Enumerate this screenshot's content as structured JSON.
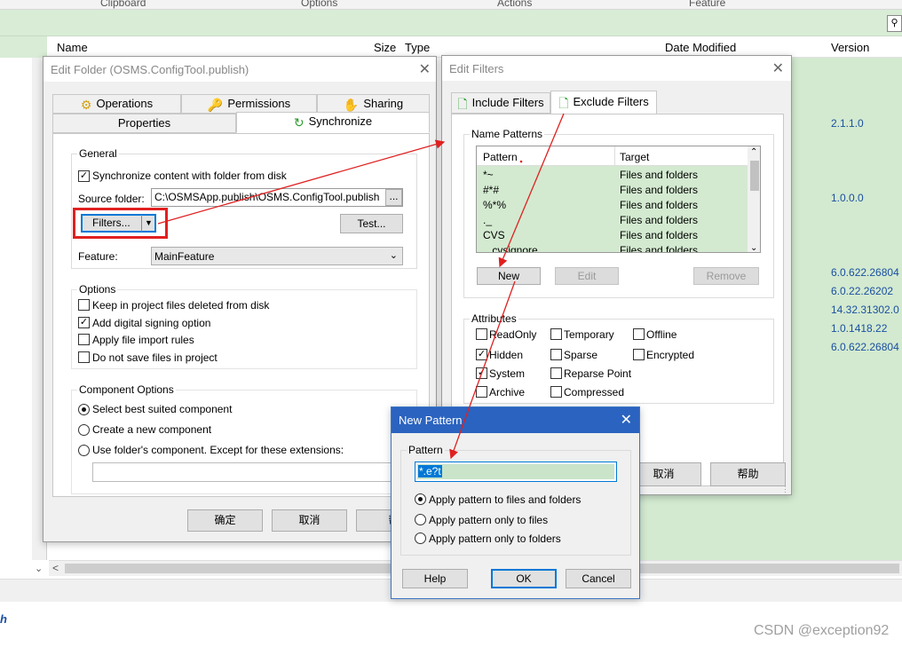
{
  "ribbon": {
    "groups": [
      "Clipboard",
      "Options",
      "Actions",
      "Feature"
    ]
  },
  "search_icon": "search-icon",
  "list": {
    "headers": {
      "name": "Name",
      "size": "Size",
      "type": "Type",
      "date_modified": "Date Modified",
      "version": "Version"
    },
    "versions": [
      "2.1.1.0",
      "1.0.0.0",
      "6.0.622.26804",
      "6.0.22.26202",
      "14.32.31302.0",
      "1.0.1418.22",
      "6.0.622.26804"
    ]
  },
  "bottom_link": "h",
  "watermark": "CSDN @exception92",
  "edit_folder": {
    "title": "Edit Folder (OSMS.ConfigTool.publish)",
    "tabs": [
      "Operations",
      "Permissions",
      "Sharing",
      "Properties",
      "Synchronize"
    ],
    "general_label": "General",
    "sync_checkbox": "Synchronize content with folder from disk",
    "source_folder_label": "Source folder:",
    "source_folder_value": "C:\\OSMSApp.publish\\OSMS.ConfigTool.publish",
    "browse_label": "...",
    "filters_button": "Filters...",
    "test_button": "Test...",
    "feature_label": "Feature:",
    "feature_value": "MainFeature",
    "options_label": "Options",
    "options": [
      "Keep in project files deleted from disk",
      "Add digital signing option",
      "Apply file import rules",
      "Do not save files in project"
    ],
    "options_checked": [
      false,
      true,
      false,
      false
    ],
    "component_label": "Component Options",
    "component_options": [
      "Select best suited component",
      "Create  a new component",
      "Use folder's component. Except for these extensions:"
    ],
    "ok": "确定",
    "cancel": "取消",
    "help": "帮"
  },
  "edit_filters": {
    "title": "Edit Filters",
    "tabs": [
      "Include Filters",
      "Exclude Filters"
    ],
    "name_patterns_label": "Name Patterns",
    "col_pattern": "Pattern",
    "col_target": "Target",
    "rows": [
      {
        "pattern": "*~",
        "target": "Files and folders"
      },
      {
        "pattern": "#*#",
        "target": "Files and folders"
      },
      {
        "pattern": "%*%",
        "target": "Files and folders"
      },
      {
        "pattern": "._",
        "target": "Files and folders"
      },
      {
        "pattern": "CVS",
        "target": "Files and folders"
      },
      {
        "pattern": ".cvsignore",
        "target": "Files and folders"
      }
    ],
    "new": "New",
    "edit": "Edit",
    "remove": "Remove",
    "attributes_label": "Attributes",
    "attributes": [
      {
        "label": "ReadOnly",
        "checked": false
      },
      {
        "label": "Temporary",
        "checked": false
      },
      {
        "label": "Offline",
        "checked": false
      },
      {
        "label": "Hidden",
        "checked": true
      },
      {
        "label": "Sparse",
        "checked": false
      },
      {
        "label": "Encrypted",
        "checked": false
      },
      {
        "label": "System",
        "checked": true
      },
      {
        "label": "Reparse Point",
        "checked": false
      },
      {
        "label": "Archive",
        "checked": false
      },
      {
        "label": "Compressed",
        "checked": false
      }
    ],
    "cancel": "取消",
    "help": "帮助"
  },
  "new_pattern": {
    "title": "New Pattern",
    "group_label": "Pattern",
    "value": "*.e?t",
    "radios": [
      "Apply pattern to files and folders",
      "Apply pattern only to files",
      "Apply pattern only to folders"
    ],
    "help": "Help",
    "ok": "OK",
    "cancel": "Cancel"
  },
  "colors": {
    "accent": "#0078d7",
    "highlight_row": "#d3ead0",
    "annotation": "#e02020"
  }
}
